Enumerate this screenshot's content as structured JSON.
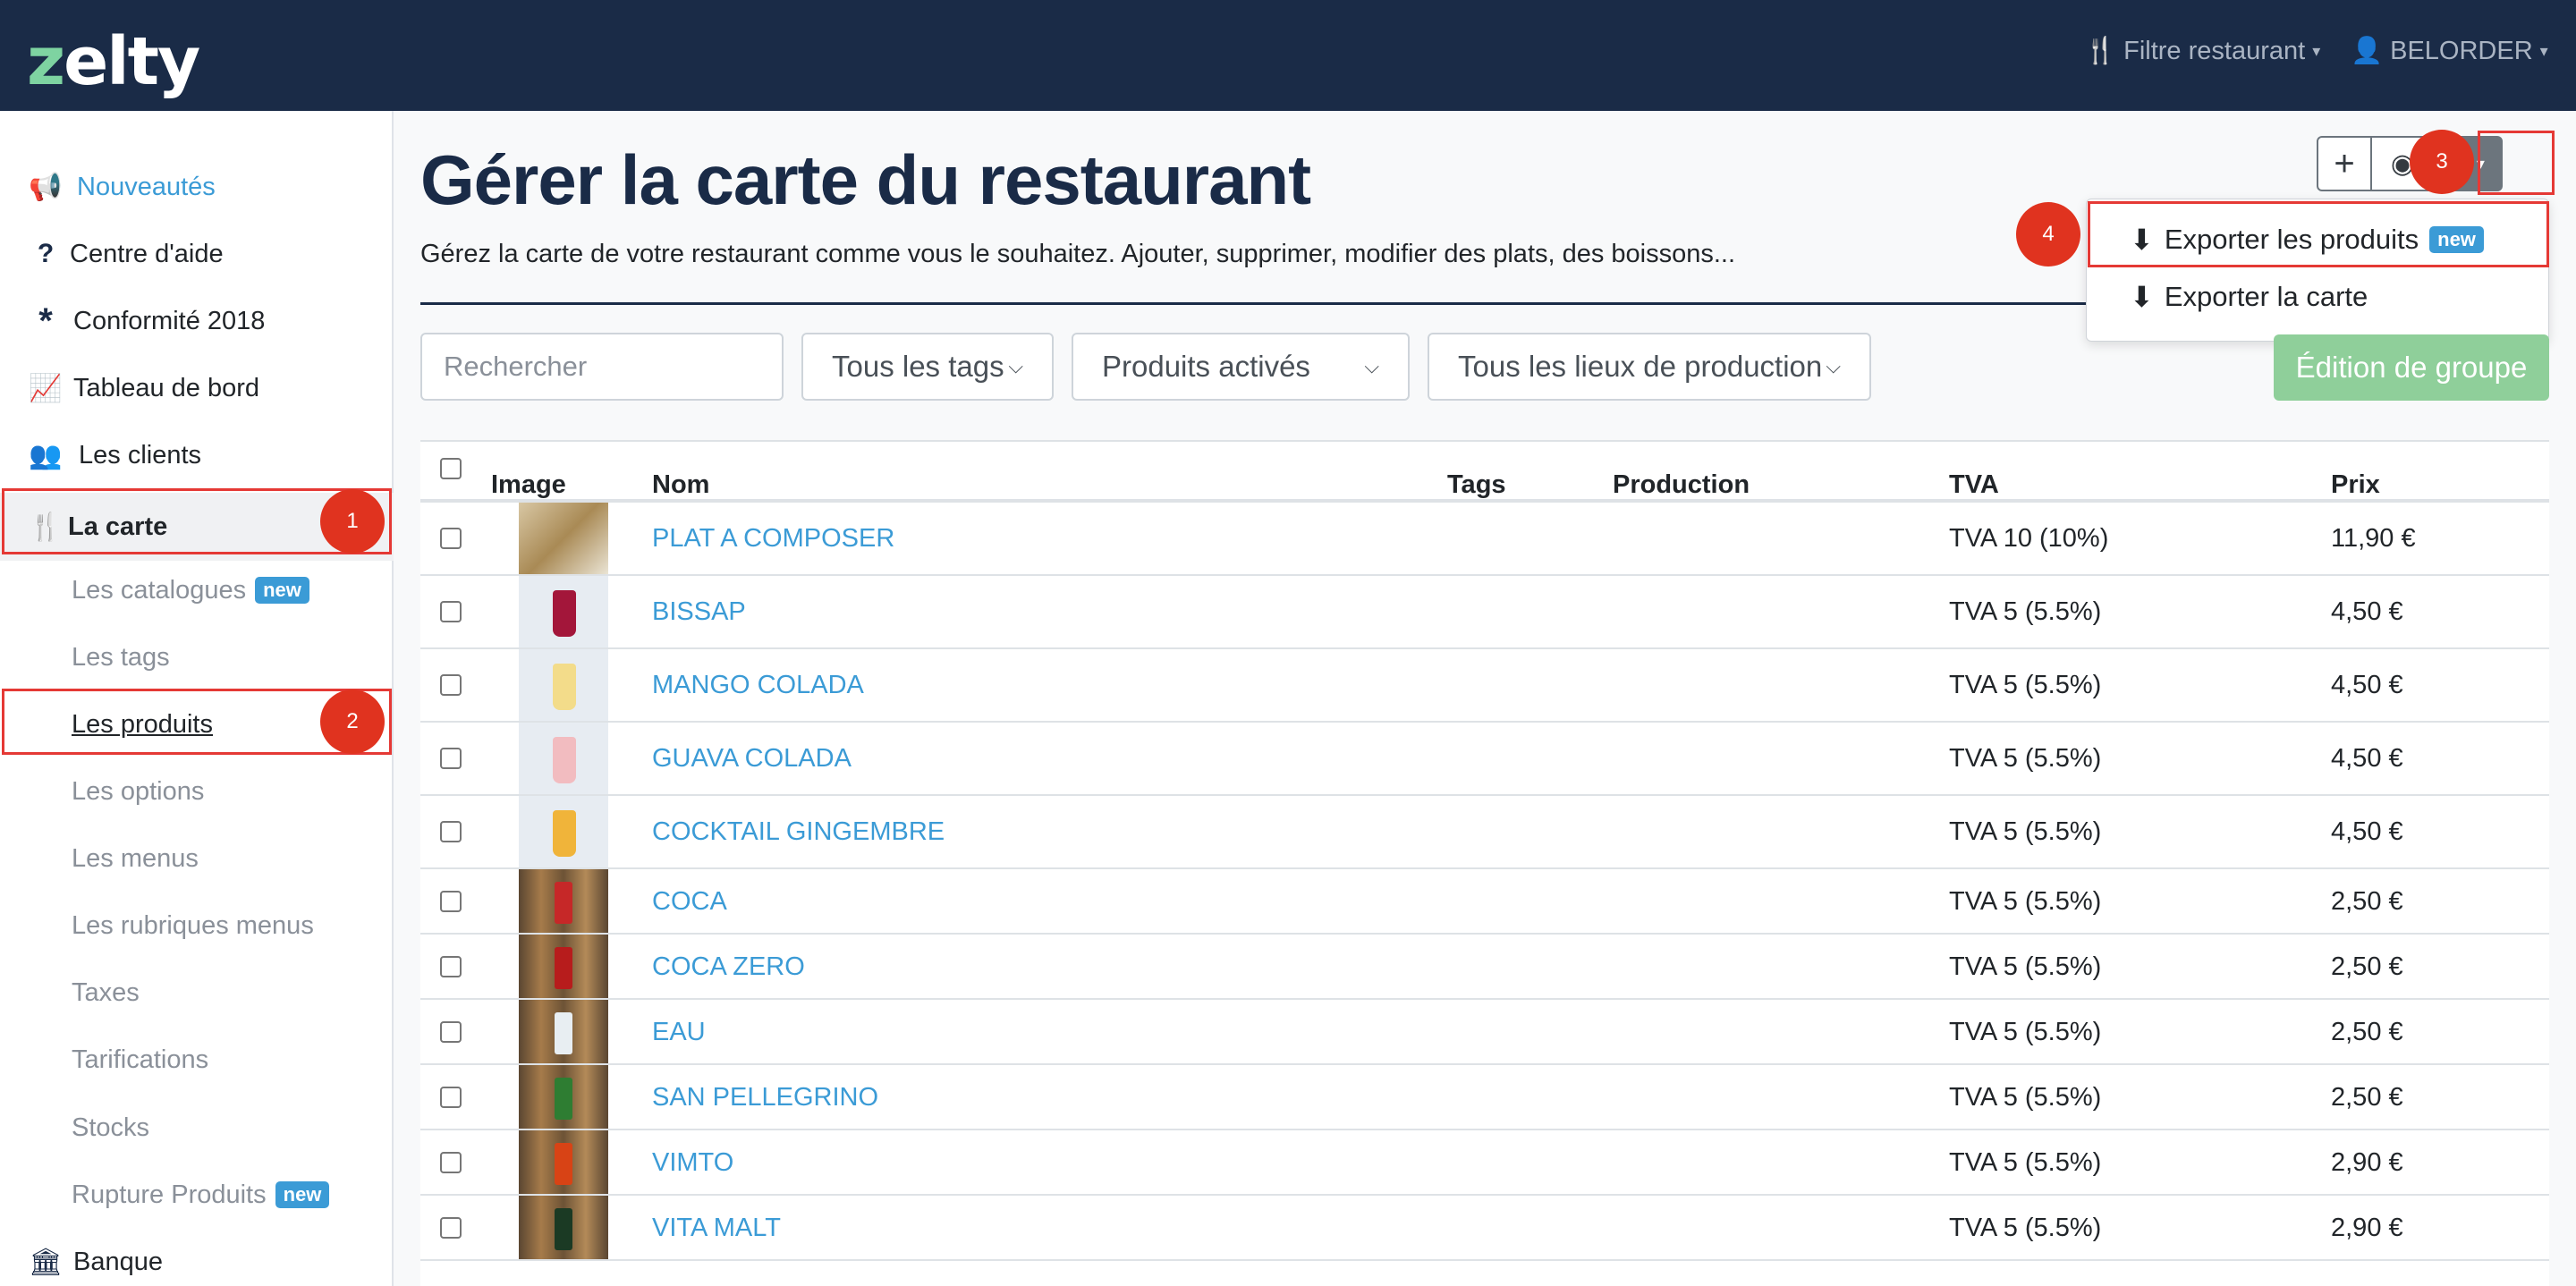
{
  "brand": {
    "logo_prefix": "z",
    "logo_rest": "elty"
  },
  "navbar": {
    "restaurant_filter": "Filtre restaurant",
    "user": "BELORDER"
  },
  "sidebar": {
    "items": [
      {
        "label": "Nouveautés",
        "icon": "megaphone-icon"
      },
      {
        "label": "Centre d'aide",
        "icon": "question-icon"
      },
      {
        "label": "Conformité 2018",
        "icon": "asterisk-icon"
      },
      {
        "label": "Tableau de bord",
        "icon": "chart-icon"
      },
      {
        "label": "Les clients",
        "icon": "users-icon"
      },
      {
        "label": "La carte",
        "icon": "utensils-icon"
      },
      {
        "label": "Les catalogues",
        "badge": "new"
      },
      {
        "label": "Les tags"
      },
      {
        "label": "Les produits"
      },
      {
        "label": "Les options"
      },
      {
        "label": "Les menus"
      },
      {
        "label": "Les rubriques menus"
      },
      {
        "label": "Taxes"
      },
      {
        "label": "Tarifications"
      },
      {
        "label": "Stocks"
      },
      {
        "label": "Rupture Produits",
        "badge": "new"
      },
      {
        "label": "Banque",
        "icon": "bank-icon"
      }
    ]
  },
  "markers": [
    "1",
    "2",
    "3",
    "4"
  ],
  "page": {
    "title": "Gérer la carte du restaurant",
    "subtitle": "Gérez la carte de votre restaurant comme vous le souhaitez. Ajouter, supprimer, modifier des plats, des boissons..."
  },
  "toolbar": {
    "add": "+",
    "view": "◉"
  },
  "export_menu": {
    "export_products": "Exporter les produits",
    "export_products_badge": "new",
    "export_menu": "Exporter la carte"
  },
  "filters": {
    "search_placeholder": "Rechercher",
    "tags": "Tous les tags",
    "status": "Produits activés",
    "production": "Tous les lieux de production",
    "group_edit": "Édition de groupe"
  },
  "table": {
    "columns": [
      "Image",
      "Nom",
      "Tags",
      "Production",
      "TVA",
      "Prix"
    ],
    "rows": [
      {
        "name": "PLAT A COMPOSER",
        "tags": "",
        "production": "",
        "tva": "TVA 10 (10%)",
        "price": "11,90 €",
        "image": "food",
        "color": "#c9a85c"
      },
      {
        "name": "BISSAP",
        "tags": "",
        "production": "",
        "tva": "TVA 5 (5.5%)",
        "price": "4,50 €",
        "image": "drink",
        "color": "#a3163a"
      },
      {
        "name": "MANGO COLADA",
        "tags": "",
        "production": "",
        "tva": "TVA 5 (5.5%)",
        "price": "4,50 €",
        "image": "drink",
        "color": "#f3dc8a"
      },
      {
        "name": "GUAVA COLADA",
        "tags": "",
        "production": "",
        "tva": "TVA 5 (5.5%)",
        "price": "4,50 €",
        "image": "drink",
        "color": "#f2bcc0"
      },
      {
        "name": "COCKTAIL GINGEMBRE",
        "tags": "",
        "production": "",
        "tva": "TVA 5 (5.5%)",
        "price": "4,50 €",
        "image": "drink",
        "color": "#f0b43a"
      },
      {
        "name": "COCA",
        "tags": "",
        "production": "",
        "tva": "TVA 5 (5.5%)",
        "price": "2,50 €",
        "image": "can",
        "color": "#c62828"
      },
      {
        "name": "COCA ZERO",
        "tags": "",
        "production": "",
        "tva": "TVA 5 (5.5%)",
        "price": "2,50 €",
        "image": "can",
        "color": "#b71c1c"
      },
      {
        "name": "EAU",
        "tags": "",
        "production": "",
        "tva": "TVA 5 (5.5%)",
        "price": "2,50 €",
        "image": "can",
        "color": "#e8eef2"
      },
      {
        "name": "SAN PELLEGRINO",
        "tags": "",
        "production": "",
        "tva": "TVA 5 (5.5%)",
        "price": "2,50 €",
        "image": "can",
        "color": "#2e7d32"
      },
      {
        "name": "VIMTO",
        "tags": "",
        "production": "",
        "tva": "TVA 5 (5.5%)",
        "price": "2,90 €",
        "image": "can",
        "color": "#d84315"
      },
      {
        "name": "VITA MALT",
        "tags": "",
        "production": "",
        "tva": "TVA 5 (5.5%)",
        "price": "2,90 €",
        "image": "can",
        "color": "#1b3a24"
      }
    ]
  }
}
